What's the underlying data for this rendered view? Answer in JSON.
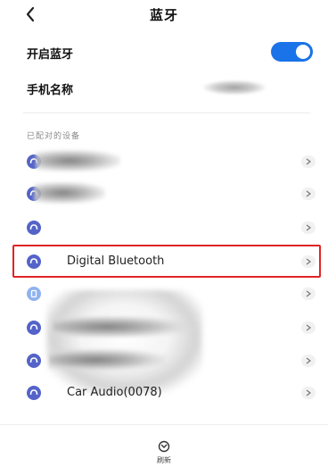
{
  "header": {
    "title": "蓝牙",
    "back_icon": "chevron-left-icon"
  },
  "bluetooth_toggle": {
    "label": "开启蓝牙",
    "enabled": true,
    "accent_color": "#1a73e8"
  },
  "phone_name": {
    "label": "手机名称",
    "value_obscured": true
  },
  "paired_section": {
    "title": "已配对的设备"
  },
  "devices": [
    {
      "name": "",
      "obscured": true,
      "icon": "bluetooth-device-icon"
    },
    {
      "name": "",
      "obscured": true,
      "icon": "bluetooth-device-icon"
    },
    {
      "name": "",
      "obscured": false,
      "icon": "headphones-icon"
    },
    {
      "name": "Digital Bluetooth",
      "obscured": false,
      "icon": "headphones-icon",
      "highlighted": true,
      "highlight_color": "#e02424"
    },
    {
      "name": "",
      "obscured": false,
      "icon": "device-icon"
    },
    {
      "name": "",
      "obscured": true,
      "icon": "bluetooth-device-icon"
    },
    {
      "name": "",
      "obscured": true,
      "icon": "bluetooth-device-icon"
    },
    {
      "name": "Car Audio(0078)",
      "obscured": false,
      "icon": "headphones-icon"
    }
  ],
  "bottom_bar": {
    "refresh_label": "刷新",
    "refresh_icon": "refresh-icon"
  }
}
